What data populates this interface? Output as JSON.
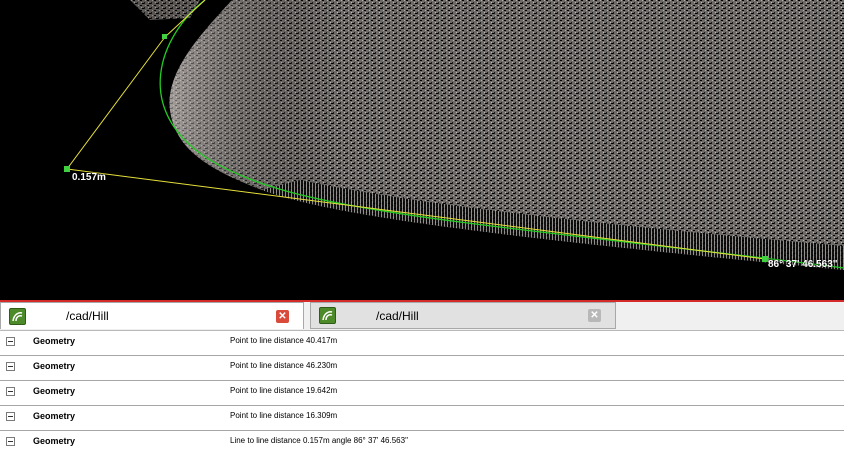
{
  "viewport": {
    "distance_label": "0.157m",
    "angle_label": "86° 37' 46.563\"",
    "colors": {
      "background": "#000000",
      "measure_line": "#e6e03a",
      "curve": "#22cc22",
      "point_cloud": "#8a8582",
      "selection_bar": "#d42a2a"
    }
  },
  "tabs": [
    {
      "title": "/cad/Hill",
      "icon": "layer-icon",
      "close_icon": "close-icon",
      "state": "active"
    },
    {
      "title": "/cad/Hill",
      "icon": "layer-icon",
      "close_icon": "close-icon",
      "state": "inactive"
    }
  ],
  "results": [
    {
      "name": "Geometry",
      "description": "Point to line distance  40.417m"
    },
    {
      "name": "Geometry",
      "description": "Point to line distance  46.230m"
    },
    {
      "name": "Geometry",
      "description": "Point to line distance  19.642m"
    },
    {
      "name": "Geometry",
      "description": "Point to line distance  16.309m"
    },
    {
      "name": "Geometry",
      "description": "Line to line distance  0.157m  angle 86° 37' 46.563\""
    }
  ]
}
